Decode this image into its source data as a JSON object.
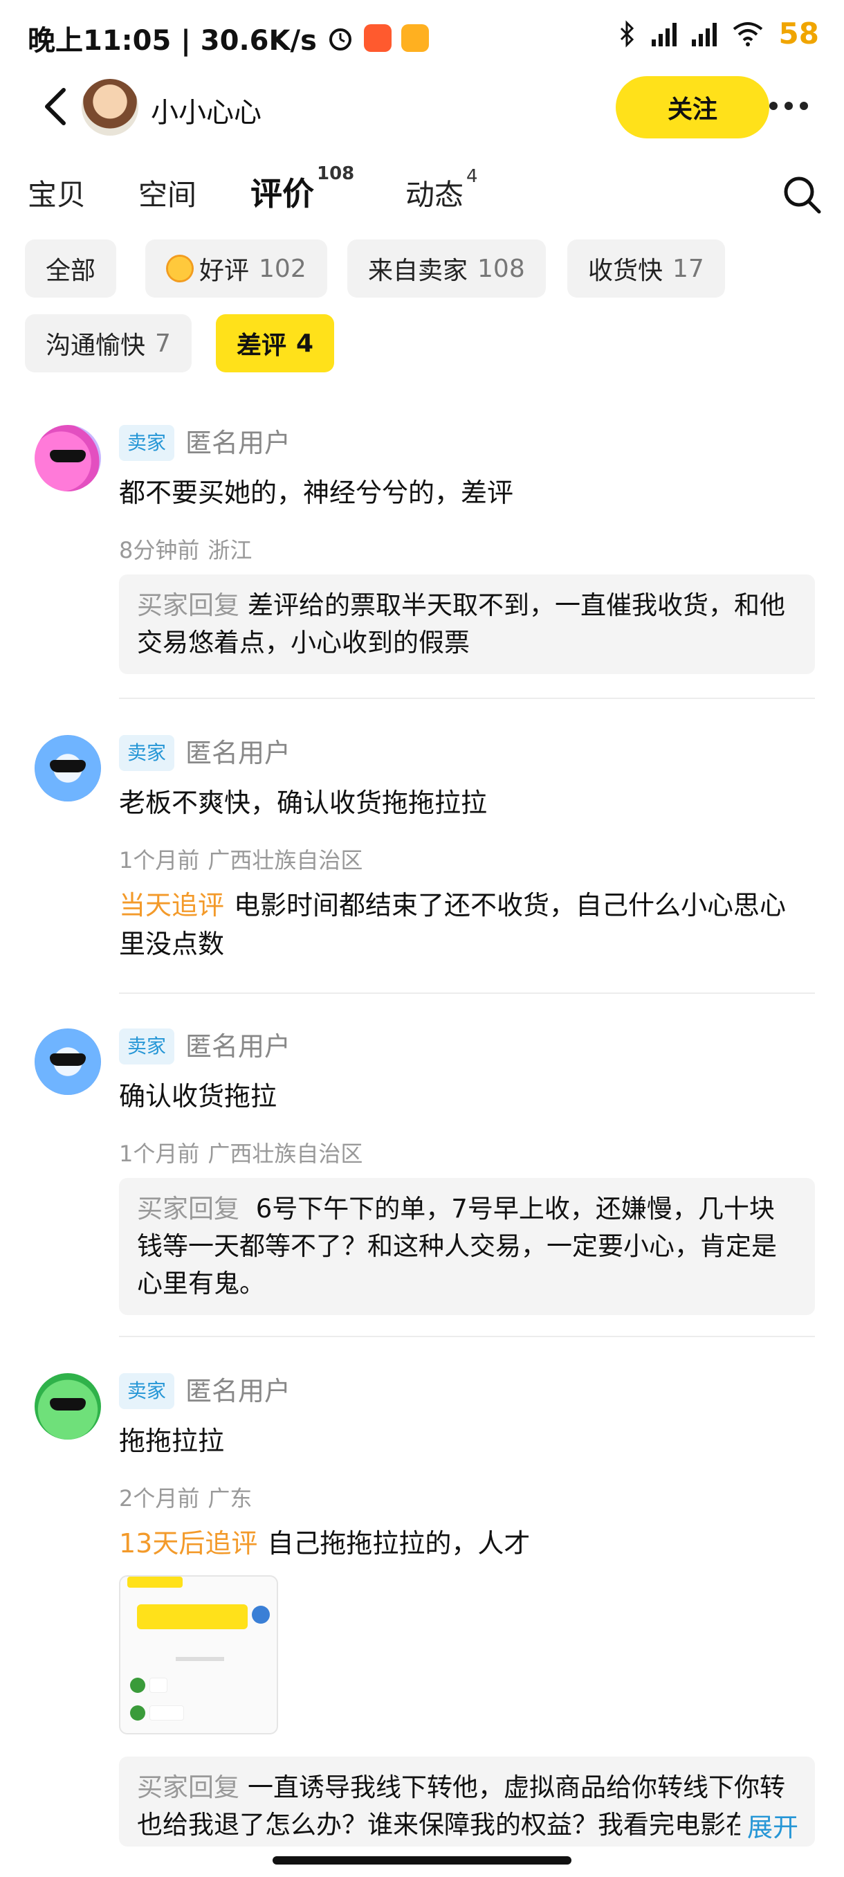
{
  "status_bar": {
    "time_speed": "晚上11:05 | 30.6K/s",
    "battery": "58",
    "icons": [
      "alarm-icon",
      "app-icon",
      "app-icon",
      "bluetooth-icon",
      "signal-icon",
      "signal-icon",
      "wifi-icon"
    ]
  },
  "header": {
    "shop_name": "小小心心",
    "follow_label": "关注",
    "icons": [
      "back-arrow-icon",
      "more-dots-icon"
    ]
  },
  "tabs": [
    {
      "label": "宝贝",
      "count": ""
    },
    {
      "label": "空间",
      "count": ""
    },
    {
      "label": "评价",
      "count": "108",
      "active": true
    },
    {
      "label": "动态",
      "count": "4"
    }
  ],
  "filters": [
    {
      "label": "全部",
      "count": ""
    },
    {
      "label": "好评",
      "count": "102",
      "icon": "smile-face-icon"
    },
    {
      "label": "来自卖家",
      "count": "108"
    },
    {
      "label": "收货快",
      "count": "17"
    },
    {
      "label": "沟通愉快",
      "count": "7"
    },
    {
      "label": "差评",
      "count": "4",
      "active": true
    }
  ],
  "reviews": [
    {
      "role": "卖家",
      "user": "匿名用户",
      "text": "都不要买她的，神经兮兮的，差评",
      "time": "8分钟前",
      "location": "浙江",
      "reply_label": "买家回复",
      "reply": "差评给的票取半天取不到，一直催我收货，和他交易悠着点，小心收到的假票"
    },
    {
      "role": "卖家",
      "user": "匿名用户",
      "text": "老板不爽快，确认收货拖拖拉拉",
      "time": "1个月前",
      "location": "广西壮族自治区",
      "followup_label": "当天追评",
      "followup": "电影时间都结束了还不收货，自己什么小心思心里没点数"
    },
    {
      "role": "卖家",
      "user": "匿名用户",
      "text": "确认收货拖拉",
      "time": "1个月前",
      "location": "广西壮族自治区",
      "reply_label": "买家回复",
      "reply": " 6号下午下的单，7号早上收，还嫌慢，几十块钱等一天都等不了？和这种人交易，一定要小心，肯定是心里有鬼。"
    },
    {
      "role": "卖家",
      "user": "匿名用户",
      "text": "拖拖拉拉",
      "time": "2个月前",
      "location": "广东",
      "followup_label": "13天后追评",
      "followup": "自己拖拖拉拉的，人才",
      "reply_label": "买家回复",
      "reply": "一直诱导我线下转他，虚拟商品给你转线下你转也给我退了怎么办？谁来保障我的权益？我看完电影在",
      "expand_label": "展开"
    }
  ],
  "colors": {
    "accent_yellow": "#ffe11a",
    "followup_orange": "#f39a2a",
    "role_badge_blue": "#2596d6",
    "battery_yellow": "#f0a500"
  }
}
